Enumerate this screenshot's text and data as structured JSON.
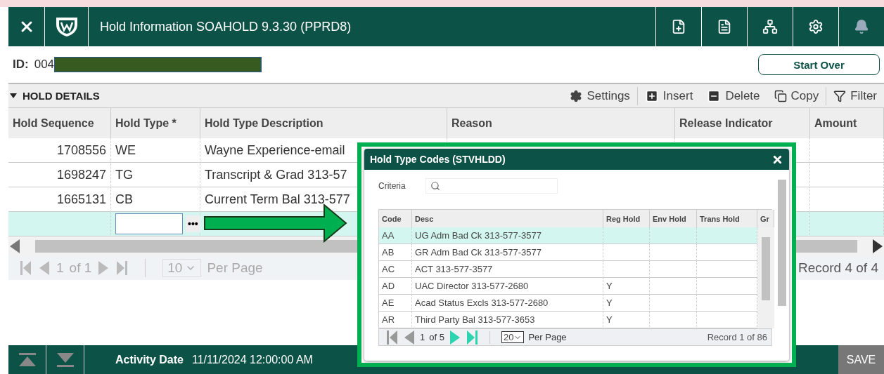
{
  "header": {
    "title": "Hold Information SOAHOLD 9.3.30 (PPRD8)"
  },
  "id_field": {
    "label": "ID:",
    "value": "004"
  },
  "start_over": "Start Over",
  "section": {
    "title": "HOLD DETAILS",
    "expanded": true,
    "actions": [
      {
        "kind": "settings",
        "label": "Settings"
      },
      {
        "kind": "insert",
        "label": "Insert"
      },
      {
        "kind": "delete",
        "label": "Delete"
      },
      {
        "kind": "copy",
        "label": "Copy"
      },
      {
        "kind": "filter",
        "label": "Filter"
      }
    ]
  },
  "table": {
    "columns": [
      "Hold Sequence",
      "Hold Type *",
      "Hold Type Description",
      "Reason",
      "Release Indicator",
      "Amount"
    ],
    "rows": [
      {
        "selected": false,
        "cells": [
          "1708556",
          "WE",
          "Wayne Experience-email",
          "",
          "",
          ""
        ]
      },
      {
        "selected": false,
        "cells": [
          "1698247",
          "TG",
          "Transcript & Grad 313-57",
          "",
          "",
          ""
        ]
      },
      {
        "selected": false,
        "cells": [
          "1665131",
          "CB",
          "Current Term Bal 313-577",
          "",
          "",
          ""
        ]
      },
      {
        "selected": true,
        "cells": [
          "",
          "",
          "",
          "",
          "",
          ""
        ]
      }
    ]
  },
  "lookup_button": "•••",
  "pager": {
    "page": "1",
    "of": "of 1",
    "per_page": "10",
    "per_page_label": "Per Page",
    "record": "Record 4 of 4"
  },
  "dialog": {
    "title": "Hold Type Codes (STVHLDD)",
    "criteria_label": "Criteria",
    "columns": [
      "Code",
      "Desc",
      "Reg Hold",
      "Env Hold",
      "Trans Hold",
      "Gr"
    ],
    "rows": [
      {
        "selected": true,
        "cells": [
          "AA",
          "UG Adm Bad Ck 313-577-3577",
          "",
          "",
          ""
        ]
      },
      {
        "selected": false,
        "cells": [
          "AB",
          "GR Adm Bad Ck 313-577-3577",
          "",
          "",
          ""
        ]
      },
      {
        "selected": false,
        "cells": [
          "AC",
          "ACT 313-577-3577",
          "",
          "",
          ""
        ]
      },
      {
        "selected": false,
        "cells": [
          "AD",
          "UAC Director 313-577-2680",
          "Y",
          "",
          ""
        ]
      },
      {
        "selected": false,
        "cells": [
          "AE",
          "Acad Status Excls 313-577-2680",
          "Y",
          "",
          ""
        ]
      },
      {
        "selected": false,
        "cells": [
          "AR",
          "Third Party Bal 313-577-3653",
          "Y",
          "",
          ""
        ]
      }
    ],
    "pager": {
      "page": "1",
      "of": "of 5",
      "per_page": "20",
      "per_page_label": "Per Page",
      "record": "Record 1 of 86"
    }
  },
  "footer": {
    "label": "Activity Date",
    "value": "11/11/2024 12:00:00 AM",
    "save": "SAVE"
  }
}
